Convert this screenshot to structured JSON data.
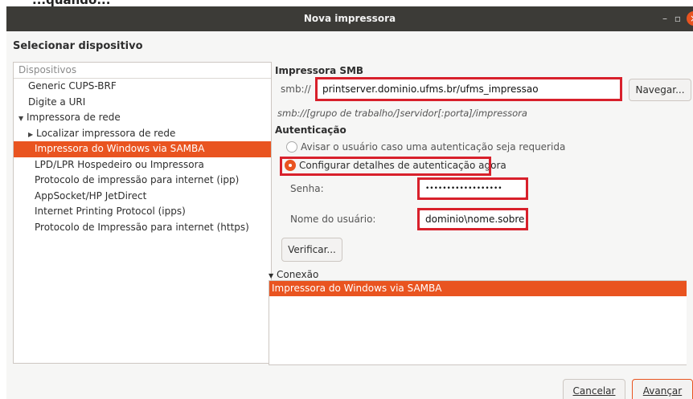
{
  "page_heading_cropped": "...quando...",
  "titlebar": {
    "title": "Nova impressora",
    "minimize_glyph": "–",
    "maximize_glyph": "▫",
    "close_glyph": "×"
  },
  "heading": "Selecionar dispositivo",
  "devices": {
    "header": "Dispositivos",
    "items": [
      {
        "label": "Generic CUPS-BRF",
        "level": 1
      },
      {
        "label": "Digite a URI",
        "level": 1
      },
      {
        "label": "Impressora de rede",
        "level": 1,
        "expander": "▼"
      },
      {
        "label": "Localizar impressora de rede",
        "level": 2,
        "expander": "▶"
      },
      {
        "label": "Impressora do Windows via SAMBA",
        "level": 2,
        "selected": true
      },
      {
        "label": "LPD/LPR Hospedeiro ou Impressora",
        "level": 2
      },
      {
        "label": "Protocolo de impressão para internet (ipp)",
        "level": 2
      },
      {
        "label": "AppSocket/HP JetDirect",
        "level": 2
      },
      {
        "label": "Internet Printing Protocol (ipps)",
        "level": 2
      },
      {
        "label": "Protocolo de Impressão para internet (https)",
        "level": 2
      }
    ]
  },
  "smb": {
    "section_title": "Impressora SMB",
    "prefix": "smb://",
    "uri_value": "printserver.dominio.ufms.br/ufms_impressao",
    "browse_label": "Navegar...",
    "hint": "smb://[grupo de trabalho/]servidor[:porta]/impressora"
  },
  "auth": {
    "section_title": "Autenticação",
    "option_prompt": "Avisar o usuário caso uma autenticação seja requerida",
    "option_now": "Configurar detalhes de autenticação agora",
    "password_label": "Senha:",
    "password_value": "••••••••••••••••••",
    "username_label": "Nome do usuário:",
    "username_value": "dominio\\nome.sobre",
    "verify_label": "Verificar..."
  },
  "connection": {
    "expander": "▼",
    "title": "Conexão",
    "selected_row": "Impressora do Windows via SAMBA"
  },
  "footer": {
    "cancel_label": "Cancelar",
    "next_label": "Avançar"
  },
  "colors": {
    "accent": "#e95420",
    "highlight_box": "#d8202b",
    "titlebar": "#3c3b37"
  }
}
